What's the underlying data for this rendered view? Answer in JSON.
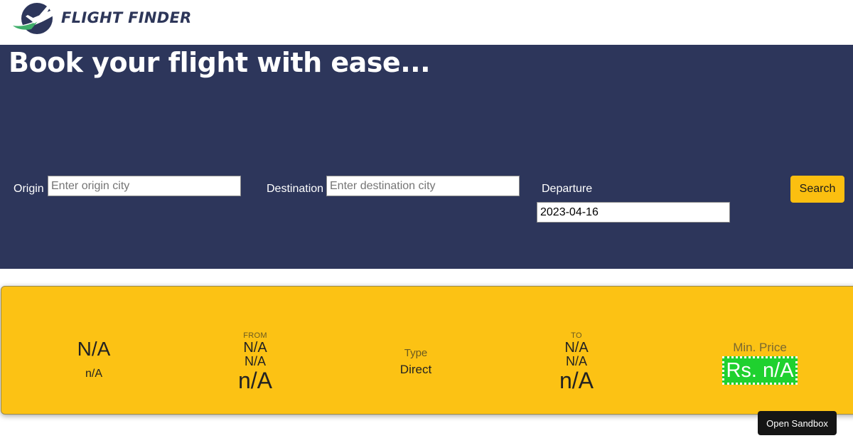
{
  "header": {
    "brand": "FLIGHT FINDER",
    "logo_icon": "plane-globe-logo-icon"
  },
  "hero": {
    "title": "Book your flight with ease..."
  },
  "search_form": {
    "origin_label": "Origin",
    "origin_placeholder": "Enter origin city",
    "destination_label": "Destination",
    "destination_placeholder": "Enter destination city",
    "departure_label": "Departure",
    "departure_value": "2023-04-16",
    "search_label": "Search"
  },
  "result_card": {
    "airline": "N/A",
    "flight_no": "n/A",
    "from": {
      "caption": "FROM",
      "city": "N/A",
      "code": "N/A",
      "time": "n/A"
    },
    "type": {
      "caption": "Type",
      "value": "Direct"
    },
    "to": {
      "caption": "TO",
      "city": "N/A",
      "code": "N/A",
      "time": "n/A"
    },
    "price": {
      "caption": "Min. Price",
      "value": "Rs. n/A"
    }
  },
  "colors": {
    "navy": "#2d365b",
    "yellow": "#fcc214",
    "price_green": "#1fd12f"
  },
  "sandbox": {
    "label": "Open Sandbox"
  }
}
